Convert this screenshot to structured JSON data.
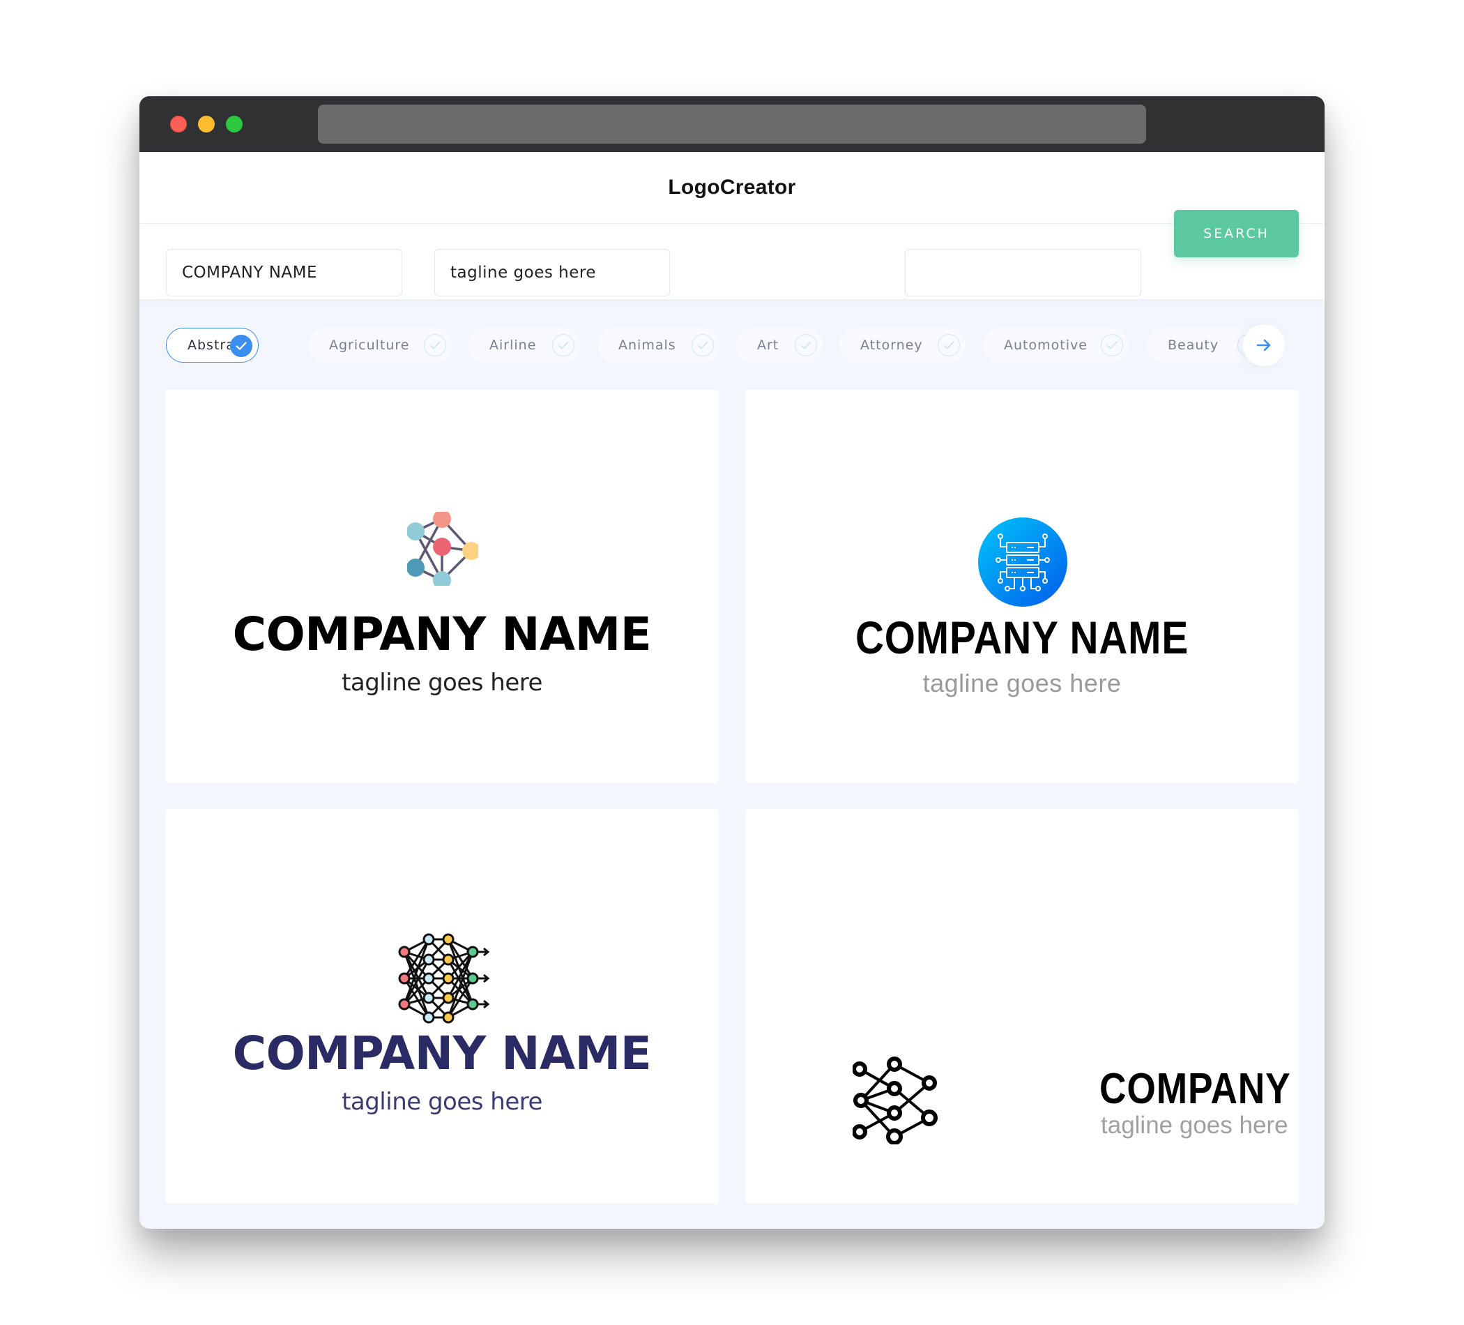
{
  "window": {
    "traffic_lights": [
      "close",
      "minimize",
      "maximize"
    ],
    "url": ""
  },
  "header": {
    "title": "LogoCreator"
  },
  "search": {
    "company_value": "COMPANY NAME",
    "tagline_value": "tagline goes here",
    "extra_value": "",
    "button_label": "SEARCH"
  },
  "filters": {
    "chips": [
      {
        "label": "Abstract",
        "selected": true
      },
      {
        "label": "Agriculture",
        "selected": false
      },
      {
        "label": "Airline",
        "selected": false
      },
      {
        "label": "Animals",
        "selected": false
      },
      {
        "label": "Art",
        "selected": false
      },
      {
        "label": "Attorney",
        "selected": false
      },
      {
        "label": "Automotive",
        "selected": false
      },
      {
        "label": "Beauty",
        "selected": false
      }
    ],
    "next_icon": "arrow-right-icon"
  },
  "logos": [
    {
      "icon": "molecule-network-icon",
      "name": "COMPANY NAME",
      "tagline": "tagline goes here",
      "name_color": "#000000",
      "tagline_color": "#222222"
    },
    {
      "icon": "server-circuit-icon",
      "name": "COMPANY NAME",
      "tagline": "tagline goes here",
      "name_color": "#000000",
      "tagline_color": "#9a9a9a",
      "icon_gradient": [
        "#00c6fb",
        "#005bea"
      ]
    },
    {
      "icon": "neural-network-icon",
      "name": "COMPANY NAME",
      "tagline": "tagline goes here",
      "name_color": "#2a2a64",
      "tagline_color": "#3c3c74"
    },
    {
      "icon": "node-graph-icon",
      "name": "COMPANY NAME",
      "tagline": "tagline goes here",
      "name_color": "#000000",
      "tagline_color": "#a0a0a0"
    }
  ],
  "colors": {
    "accent": "#3b8ff0",
    "search_button": "#5bc8a0",
    "page_bg": "#f3f6fd",
    "titlebar": "#303133"
  }
}
